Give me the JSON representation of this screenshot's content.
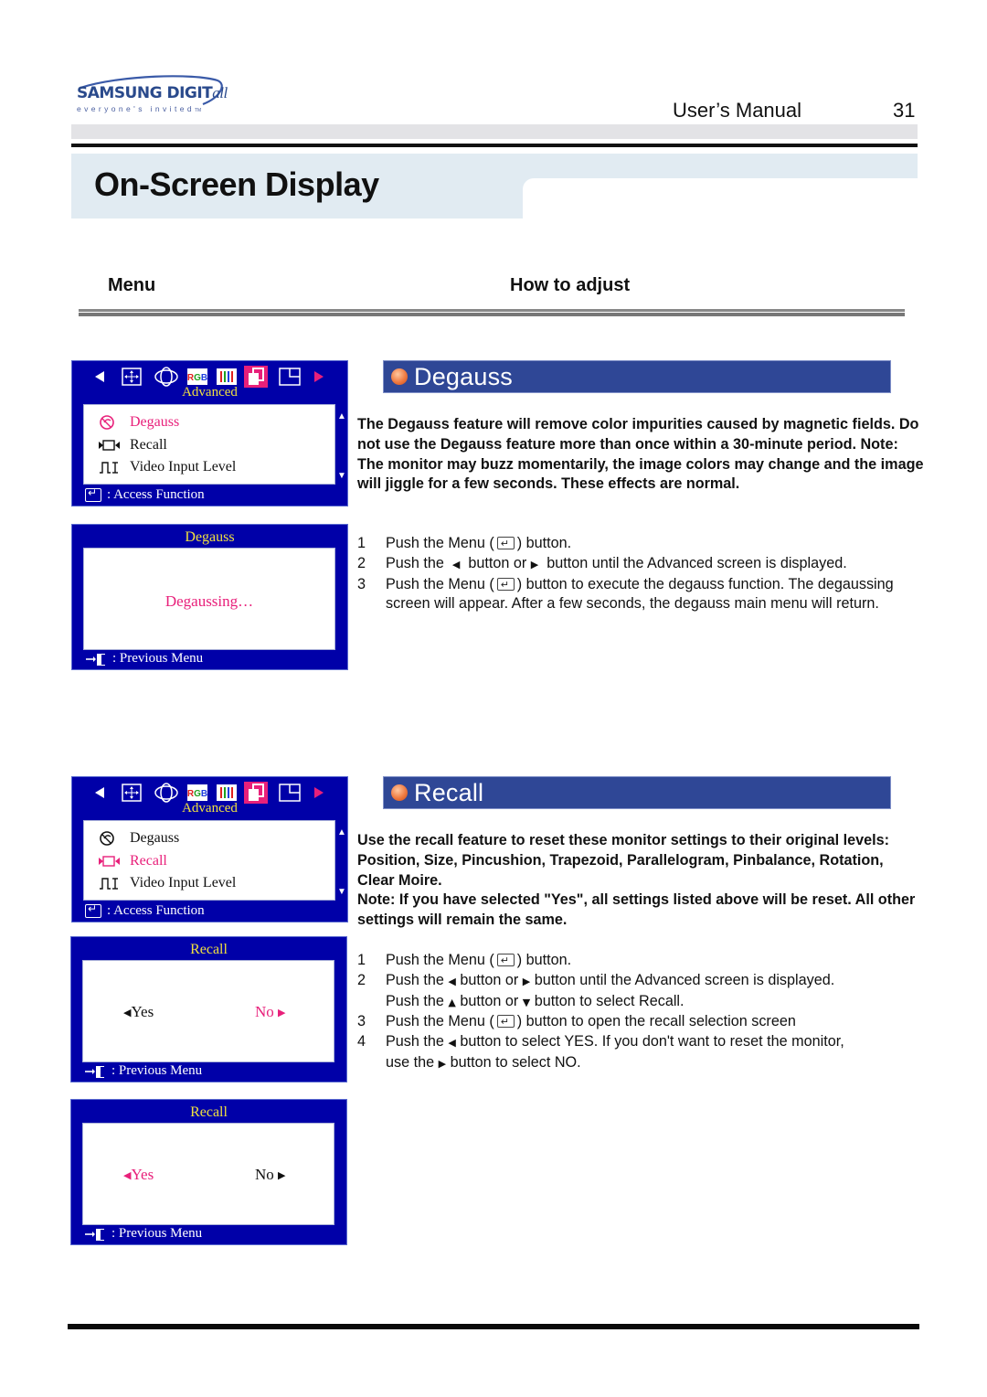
{
  "header": {
    "logo_brand": "SAMSUNG DIGIT",
    "logo_brand_suffix": "all",
    "logo_tagline": "everyone's invited",
    "logo_tm": "TM",
    "manual_label": "User’s Manual",
    "page_number": "31"
  },
  "page_title": "On-Screen Display",
  "columns": {
    "menu": "Menu",
    "how_to_adjust": "How to adjust"
  },
  "osd_icons": [
    "left-arrow",
    "position",
    "size",
    "rgb-color",
    "color-bars",
    "advanced",
    "window",
    "right-arrow"
  ],
  "osd_rgb_label": "RGB",
  "colors": {
    "osd_background": "#0000a8",
    "osd_highlight": "#e8207a",
    "osd_title": "#f0e040",
    "section_header": "#2f4796",
    "title_band": "#e1ebf2"
  },
  "sections": [
    {
      "title": "Degauss",
      "description": "The Degauss feature will remove color impurities caused by magnetic fields. Do not use the Degauss feature more than once within a 30-minute period. Note: The monitor may buzz momentarily, the image colors may change and the image will jiggle for a few seconds. These effects are normal.",
      "steps": [
        {
          "num": "1",
          "parts": [
            "Push the Menu (",
            ") button."
          ]
        },
        {
          "num": "2",
          "parts": [
            "Push the ",
            " button or ",
            " button until the Advanced screen is displayed."
          ]
        },
        {
          "num": "3",
          "parts": [
            "Push the Menu (",
            ") button to execute the degauss function. The degaussing screen will appear. After a few seconds, the degauss main menu will return."
          ]
        }
      ],
      "osd_main": {
        "category": "Advanced",
        "items": [
          "Degauss",
          "Recall",
          "Video Input Level"
        ],
        "selected": "Degauss",
        "footer": ": Access Function"
      },
      "osd_sub": {
        "title": "Degauss",
        "message": "Degaussing…",
        "footer": ": Previous Menu"
      }
    },
    {
      "title": "Recall",
      "description_lines": [
        "Use the recall feature to reset these monitor settings to their original levels: Position, Size, Pincushion, Trapezoid, Parallelogram, Pinbalance, Rotation, Clear Moire.",
        "Note: If you have selected \"Yes\", all settings listed above will be reset. All other settings will remain the same."
      ],
      "steps": [
        {
          "num": "1",
          "parts": [
            "Push the Menu (",
            ") button."
          ]
        },
        {
          "num": "2",
          "parts": [
            "Push the ",
            " button or ",
            " button until the Advanced screen is displayed."
          ],
          "extra": [
            "Push the ",
            " button or ",
            " button to select Recall."
          ]
        },
        {
          "num": "3",
          "parts": [
            "Push the Menu (",
            ") button to open the recall selection screen"
          ]
        },
        {
          "num": "4",
          "parts": [
            "Push the ",
            " button to select YES. If you don't want to reset the monitor,"
          ],
          "extra": [
            "use the ",
            " button to select NO."
          ]
        }
      ],
      "osd_main": {
        "category": "Advanced",
        "items": [
          "Degauss",
          "Recall",
          "Video Input Level"
        ],
        "selected": "Recall",
        "footer": ": Access Function"
      },
      "osd_recall_no": {
        "title": "Recall",
        "yes": "Yes",
        "no": "No",
        "selected": "No",
        "footer": ": Previous Menu"
      },
      "osd_recall_yes": {
        "title": "Recall",
        "yes": "Yes",
        "no": "No",
        "selected": "Yes",
        "footer": ": Previous Menu"
      }
    }
  ]
}
